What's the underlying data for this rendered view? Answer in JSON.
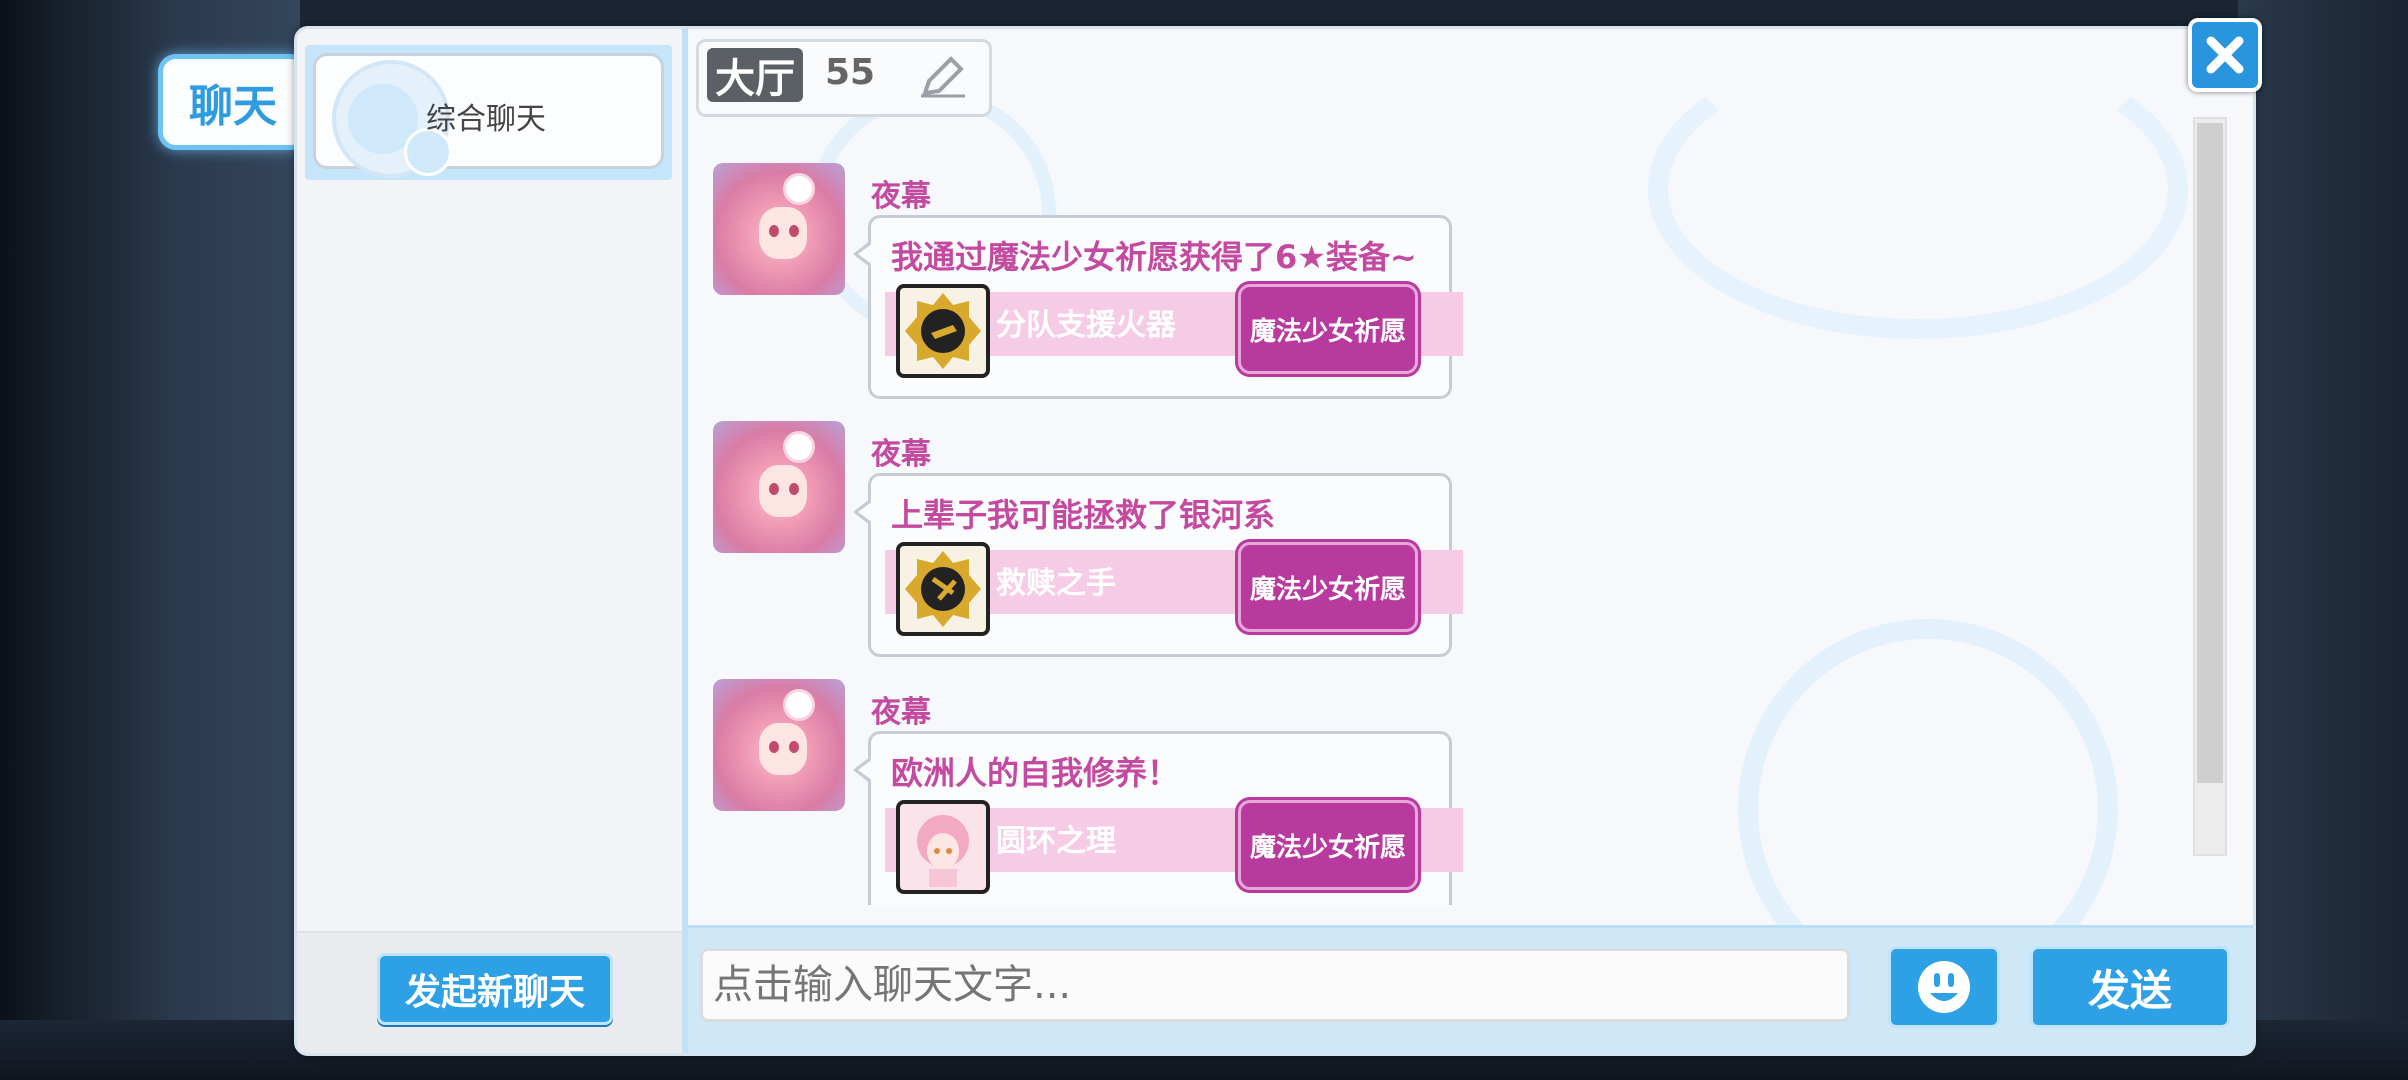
{
  "tab": {
    "label": "聊天"
  },
  "sidebar": {
    "channels": [
      {
        "label": "综合聊天"
      }
    ],
    "new_chat_label": "发起新聊天"
  },
  "header": {
    "channel": "大厅",
    "count": "55"
  },
  "messages": [
    {
      "nick": "夜幕",
      "text": "我通过魔法少女祈愿获得了6★装备~",
      "item": "分队支援火器",
      "button": "魔法少女祈愿"
    },
    {
      "nick": "夜幕",
      "text": "上辈子我可能拯救了银河系",
      "item": "救赎之手",
      "button": "魔法少女祈愿"
    },
    {
      "nick": "夜幕",
      "text": "欧洲人的自我修养！",
      "item": "圆环之理",
      "button": "魔法少女祈愿"
    }
  ],
  "input": {
    "placeholder": "点击输入聊天文字..."
  },
  "send_label": "发送",
  "icons": [
    "close-icon",
    "edit-icon",
    "emoji-icon",
    "channel-avatar-icon",
    "item-icon"
  ],
  "colors": {
    "accent": "#2ea1e6",
    "pink": "#c34aa0",
    "button_purple": "#b83a9e"
  }
}
